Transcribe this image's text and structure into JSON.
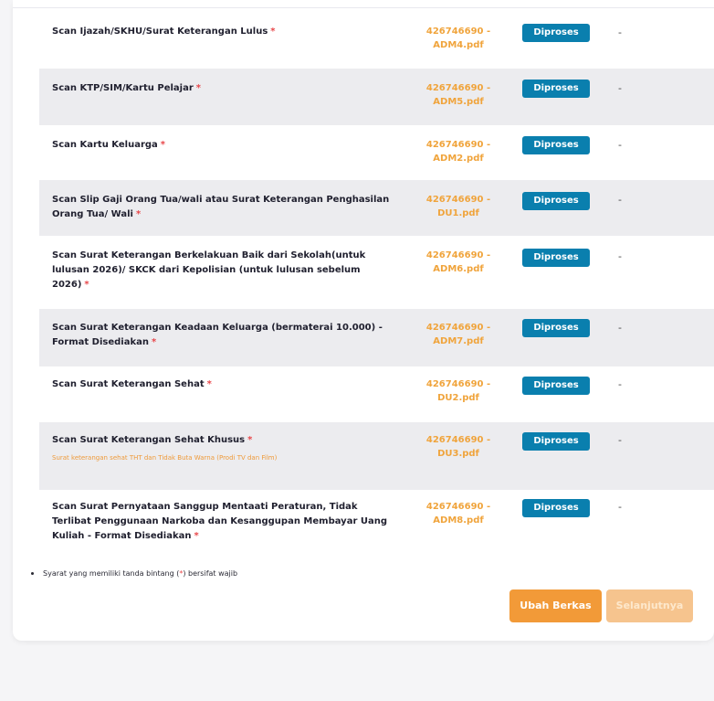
{
  "colors": {
    "accent_orange": "#f29a38",
    "badge_blue": "#0a7fae",
    "required_red": "#e8474a"
  },
  "documents": [
    {
      "label": "Scan Ijazah/SKHU/Surat Keterangan Lulus",
      "required_mark": "*",
      "note": "",
      "file_line1": "426746690 -",
      "file_line2": "ADM4.pdf",
      "status": "Diproses",
      "remark": "-"
    },
    {
      "label": "Scan KTP/SIM/Kartu Pelajar",
      "required_mark": "*",
      "note": "",
      "file_line1": "426746690 -",
      "file_line2": "ADM5.pdf",
      "status": "Diproses",
      "remark": "-"
    },
    {
      "label": "Scan Kartu Keluarga",
      "required_mark": "*",
      "note": "",
      "file_line1": "426746690 -",
      "file_line2": "ADM2.pdf",
      "status": "Diproses",
      "remark": "-"
    },
    {
      "label": "Scan Slip Gaji Orang Tua/wali atau Surat Keterangan Penghasilan Orang Tua/ Wali",
      "required_mark": "*",
      "note": "",
      "file_line1": "426746690 -",
      "file_line2": "DU1.pdf",
      "status": "Diproses",
      "remark": "-"
    },
    {
      "label": "Scan Surat Keterangan Berkelakuan Baik dari Sekolah(untuk lulusan 2026)/ SKCK dari Kepolisian (untuk lulusan sebelum 2026)",
      "required_mark": "*",
      "note": "",
      "file_line1": "426746690 -",
      "file_line2": "ADM6.pdf",
      "status": "Diproses",
      "remark": "-"
    },
    {
      "label": "Scan Surat Keterangan Keadaan Keluarga (bermaterai 10.000) - Format Disediakan",
      "required_mark": "*",
      "note": "",
      "file_line1": "426746690 -",
      "file_line2": "ADM7.pdf",
      "status": "Diproses",
      "remark": "-"
    },
    {
      "label": "Scan Surat Keterangan Sehat",
      "required_mark": "*",
      "note": "",
      "file_line1": "426746690 -",
      "file_line2": "DU2.pdf",
      "status": "Diproses",
      "remark": "-"
    },
    {
      "label": "Scan Surat Keterangan Sehat Khusus",
      "required_mark": "*",
      "note": "Surat keterangan sehat THT dan Tidak Buta Warna (Prodi TV dan Film)",
      "file_line1": "426746690 -",
      "file_line2": "DU3.pdf",
      "status": "Diproses",
      "remark": "-"
    },
    {
      "label": "Scan Surat Pernyataan Sanggup Mentaati Peraturan, Tidak Terlibat Penggunaan Narkoba dan Kesanggupan Membayar Uang Kuliah - Format Disediakan",
      "required_mark": "*",
      "note": "",
      "file_line1": "426746690 -",
      "file_line2": "ADM8.pdf",
      "status": "Diproses",
      "remark": "-"
    }
  ],
  "footnote": {
    "before": "Syarat yang memiliki tanda bintang (",
    "mark": "*",
    "after": ") bersifat wajib"
  },
  "buttons": {
    "edit": "Ubah Berkas",
    "next": "Selanjutnya"
  }
}
